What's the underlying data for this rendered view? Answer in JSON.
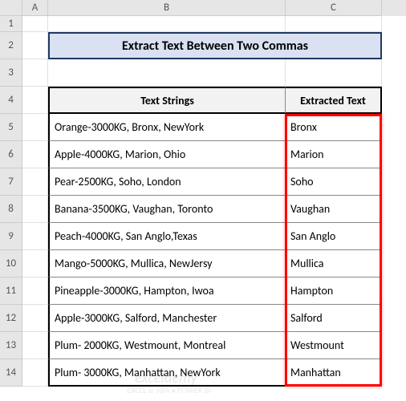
{
  "columns": [
    "A",
    "B",
    "C"
  ],
  "row_count": 14,
  "title": "Extract Text Between Two Commas",
  "headers": {
    "text_strings": "Text Strings",
    "extracted_text": "Extracted Text"
  },
  "rows": [
    {
      "text": "Orange-3000KG, Bronx, NewYork",
      "extracted": "Bronx"
    },
    {
      "text": "Apple-4000KG, Marion, Ohio",
      "extracted": "Marion"
    },
    {
      "text": "Pear-2500KG, Soho, London",
      "extracted": "Soho"
    },
    {
      "text": "Banana-3500KG, Vaughan, Toronto",
      "extracted": "Vaughan"
    },
    {
      "text": "Peach-4000KG, San Anglo,Texas",
      "extracted": "San Anglo"
    },
    {
      "text": "Mango-5000KG, Mullica, NewJersy",
      "extracted": "Mullica"
    },
    {
      "text": "Pineapple-3000KG, Hampton, Iwoa",
      "extracted": "Hampton"
    },
    {
      "text": "Apple-3000KG, Salford, Manchester",
      "extracted": "Salford"
    },
    {
      "text": "Plum- 2000KG, Westmount, Montreal",
      "extracted": "Westmount"
    },
    {
      "text": "Plum- 3000KG, Manhattan, NewYork",
      "extracted": "Manhattan"
    }
  ],
  "watermark": {
    "line1": "exceldemy",
    "line2": "EXCEL & VBA • POWER BI"
  }
}
